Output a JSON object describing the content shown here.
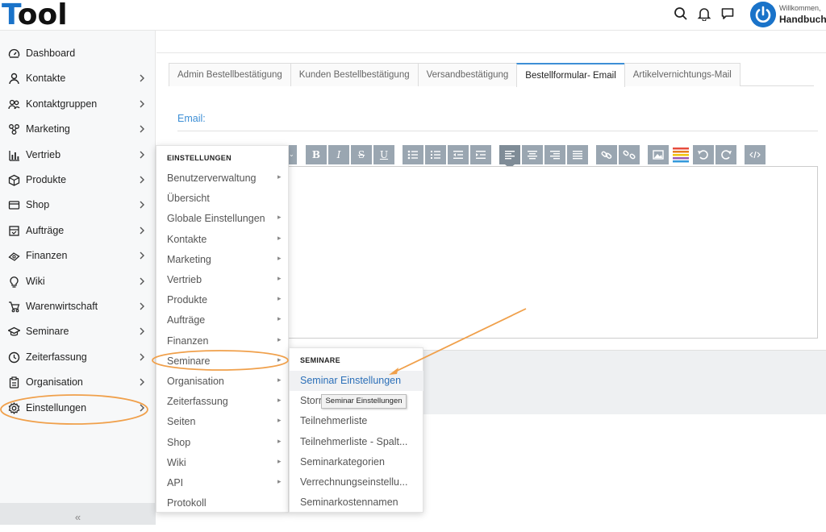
{
  "header": {
    "logo": {
      "first": "T",
      "rest": "ool"
    },
    "icons": [
      "search-icon",
      "bell-icon",
      "chat-icon"
    ],
    "user": {
      "welcome": "Willkommen,",
      "name": "Handbuch"
    }
  },
  "sidebar": {
    "items": [
      {
        "label": "Dashboard",
        "icon": "dashboard-icon",
        "chevron": false
      },
      {
        "label": "Kontakte",
        "icon": "user-icon",
        "chevron": true
      },
      {
        "label": "Kontaktgruppen",
        "icon": "users-icon",
        "chevron": true
      },
      {
        "label": "Marketing",
        "icon": "marketing-icon",
        "chevron": true
      },
      {
        "label": "Vertrieb",
        "icon": "bar-chart-icon",
        "chevron": true
      },
      {
        "label": "Produkte",
        "icon": "box-icon",
        "chevron": true
      },
      {
        "label": "Shop",
        "icon": "card-icon",
        "chevron": true
      },
      {
        "label": "Aufträge",
        "icon": "order-icon",
        "chevron": true
      },
      {
        "label": "Finanzen",
        "icon": "money-icon",
        "chevron": true
      },
      {
        "label": "Wiki",
        "icon": "bulb-icon",
        "chevron": true
      },
      {
        "label": "Warenwirtschaft",
        "icon": "cart-icon",
        "chevron": true
      },
      {
        "label": "Seminare",
        "icon": "graduation-cap-icon",
        "chevron": true
      },
      {
        "label": "Zeiterfassung",
        "icon": "clock-icon",
        "chevron": true
      },
      {
        "label": "Organisation",
        "icon": "clipboard-icon",
        "chevron": true
      },
      {
        "label": "Einstellungen",
        "icon": "gear-icon",
        "chevron": true
      }
    ],
    "collapse": "«"
  },
  "main": {
    "tabs": [
      {
        "label": "Admin Bestellbestätigung",
        "active": false
      },
      {
        "label": "Kunden Bestellbestätigung",
        "active": false
      },
      {
        "label": "Versandbestätigung",
        "active": false
      },
      {
        "label": "Bestellformular- Email",
        "active": true
      },
      {
        "label": "Artikelvernichtungs-Mail",
        "active": false
      }
    ],
    "email_label": "Email:",
    "toolbar": {
      "bold": "B",
      "italic": "I",
      "strike": "S",
      "underline": "U"
    }
  },
  "menu_einstellungen": {
    "heading": "EINSTELLUNGEN",
    "items": [
      {
        "label": "Benutzerverwaltung",
        "arrow": true
      },
      {
        "label": "Übersicht",
        "arrow": false
      },
      {
        "label": "Globale Einstellungen",
        "arrow": true
      },
      {
        "label": "Kontakte",
        "arrow": true
      },
      {
        "label": "Marketing",
        "arrow": true
      },
      {
        "label": "Vertrieb",
        "arrow": true
      },
      {
        "label": "Produkte",
        "arrow": true
      },
      {
        "label": "Aufträge",
        "arrow": true
      },
      {
        "label": "Finanzen",
        "arrow": true
      },
      {
        "label": "Seminare",
        "arrow": true
      },
      {
        "label": "Organisation",
        "arrow": true
      },
      {
        "label": "Zeiterfassung",
        "arrow": true
      },
      {
        "label": "Seiten",
        "arrow": true
      },
      {
        "label": "Shop",
        "arrow": true
      },
      {
        "label": "Wiki",
        "arrow": true
      },
      {
        "label": "API",
        "arrow": true
      },
      {
        "label": "Protokoll",
        "arrow": false
      }
    ]
  },
  "menu_seminare": {
    "heading": "SEMINARE",
    "items": [
      {
        "label": "Seminar Einstellungen",
        "active": true
      },
      {
        "label": "Storn",
        "active": false
      },
      {
        "label": "Teilnehmerliste",
        "active": false
      },
      {
        "label": "Teilnehmerliste - Spalt...",
        "active": false
      },
      {
        "label": "Seminarkategorien",
        "active": false
      },
      {
        "label": "Verrechnungseinstellu...",
        "active": false
      },
      {
        "label": "Seminarkostennamen",
        "active": false
      }
    ],
    "tooltip": "Seminar Einstellungen"
  },
  "colors": {
    "accent": "#3d8fd6",
    "annotation": "#f0a04b",
    "toolbar_button": "#9aa6b1"
  }
}
